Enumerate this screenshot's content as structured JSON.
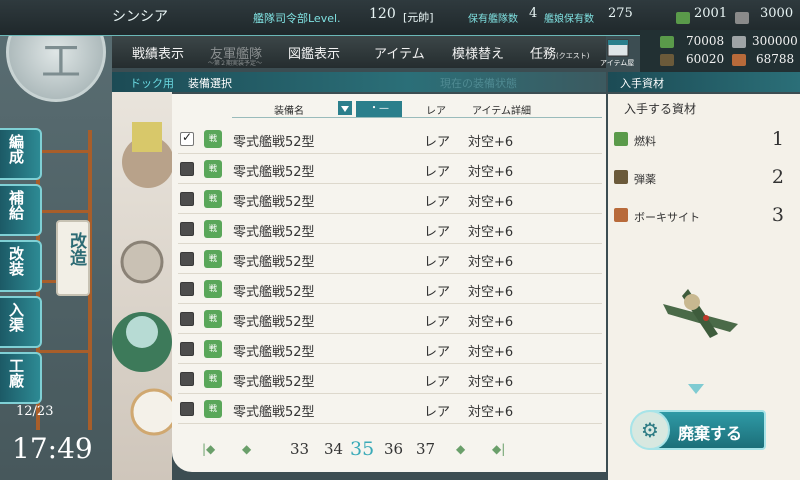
{
  "header": {
    "player_name": "シンシア",
    "hq_label": "艦隊司令部Level.",
    "hq_level": "120",
    "rank": "[元帥]",
    "ships_label": "保有艦隊数",
    "ships_value": "4",
    "shipgirls_label": "艦娘保有数",
    "shipgirls_value": "275",
    "bucket_value": "2001",
    "dev_value": "3000"
  },
  "resources": {
    "fuel": "70008",
    "ammo": "60020",
    "steel": "300000",
    "bauxite": "68788"
  },
  "nav": {
    "items": [
      "戦績表示",
      "友軍艦隊",
      "図鑑表示",
      "アイテム",
      "模様替え",
      "任務"
    ],
    "friend_sub": "～第２期実装予定～",
    "quest_sub": "(クエスト)",
    "item_shop": "アイテム屋"
  },
  "sidebar": {
    "logo": "工",
    "buttons": [
      "編成",
      "補給",
      "改装",
      "入渠",
      "工廠"
    ],
    "current_tab": "改造",
    "date": "12/23",
    "time": "17:49"
  },
  "subbar": {
    "crumb": "ドック用",
    "title": "装備選択",
    "ghost": "現在の装備状態",
    "right_title": "入手資材"
  },
  "list": {
    "col_name": "装備名",
    "sort_label": "・—",
    "col_rare": "レア",
    "col_detail": "アイテム詳細",
    "rows": [
      {
        "icon": "戦",
        "name": "零式艦戦52型",
        "rare": "レア",
        "detail": "対空+6",
        "checked": true
      },
      {
        "icon": "戦",
        "name": "零式艦戦52型",
        "rare": "レア",
        "detail": "対空+6",
        "checked": false
      },
      {
        "icon": "戦",
        "name": "零式艦戦52型",
        "rare": "レア",
        "detail": "対空+6",
        "checked": false
      },
      {
        "icon": "戦",
        "name": "零式艦戦52型",
        "rare": "レア",
        "detail": "対空+6",
        "checked": false
      },
      {
        "icon": "戦",
        "name": "零式艦戦52型",
        "rare": "レア",
        "detail": "対空+6",
        "checked": false
      },
      {
        "icon": "戦",
        "name": "零式艦戦52型",
        "rare": "レア",
        "detail": "対空+6",
        "checked": false
      },
      {
        "icon": "戦",
        "name": "零式艦戦52型",
        "rare": "レア",
        "detail": "対空+6",
        "checked": false
      },
      {
        "icon": "戦",
        "name": "零式艦戦52型",
        "rare": "レア",
        "detail": "対空+6",
        "checked": false
      },
      {
        "icon": "戦",
        "name": "零式艦戦52型",
        "rare": "レア",
        "detail": "対空+6",
        "checked": false
      },
      {
        "icon": "戦",
        "name": "零式艦戦52型",
        "rare": "レア",
        "detail": "対空+6",
        "checked": false
      }
    ],
    "pages": [
      "33",
      "34",
      "35",
      "36",
      "37"
    ],
    "current_page": "35"
  },
  "scrap": {
    "title": "入手する資材",
    "items": [
      {
        "name": "燃料",
        "value": "1",
        "color": "#5a9a4a"
      },
      {
        "name": "弾薬",
        "value": "2",
        "color": "#6b5a3a"
      },
      {
        "name": "ボーキサイト",
        "value": "3",
        "color": "#b86a3a"
      }
    ],
    "button": "廃棄する"
  },
  "colors": {
    "accent": "#2b7f8c",
    "accent_light": "#7fe0e0",
    "current_page": "#3aaab8"
  }
}
